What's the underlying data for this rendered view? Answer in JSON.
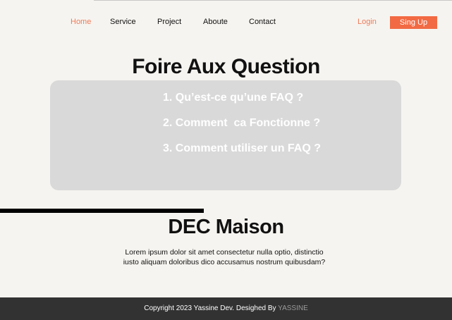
{
  "nav": {
    "items": [
      {
        "label": "Home",
        "active": true
      },
      {
        "label": "Service",
        "active": false
      },
      {
        "label": "Project",
        "active": false
      },
      {
        "label": "Aboute",
        "active": false
      },
      {
        "label": "Contact",
        "active": false
      }
    ],
    "login_label": "Login",
    "signup_label": "Sing Up"
  },
  "faq": {
    "title": "Foire Aux Question",
    "items": [
      "1. Qu’est-ce qu’une FAQ ?",
      "2. Comment  ca Fonctionne ?",
      "3. Comment utiliser un FAQ ?"
    ]
  },
  "brand": {
    "title": "DEC Maison",
    "description": "Lorem ipsum dolor sit amet consectetur  nulla optio, distinctio iusto aliquam doloribus dico accusamus nostrum quibusdam?"
  },
  "footer": {
    "text": "Copyright 2023 Yassine Dev. Desighed By ",
    "author": "YASSINE"
  },
  "colors": {
    "accent": "#f26a43",
    "background": "#f6f4f0",
    "faq_box": "#d9d9d9",
    "footer": "#323232"
  }
}
